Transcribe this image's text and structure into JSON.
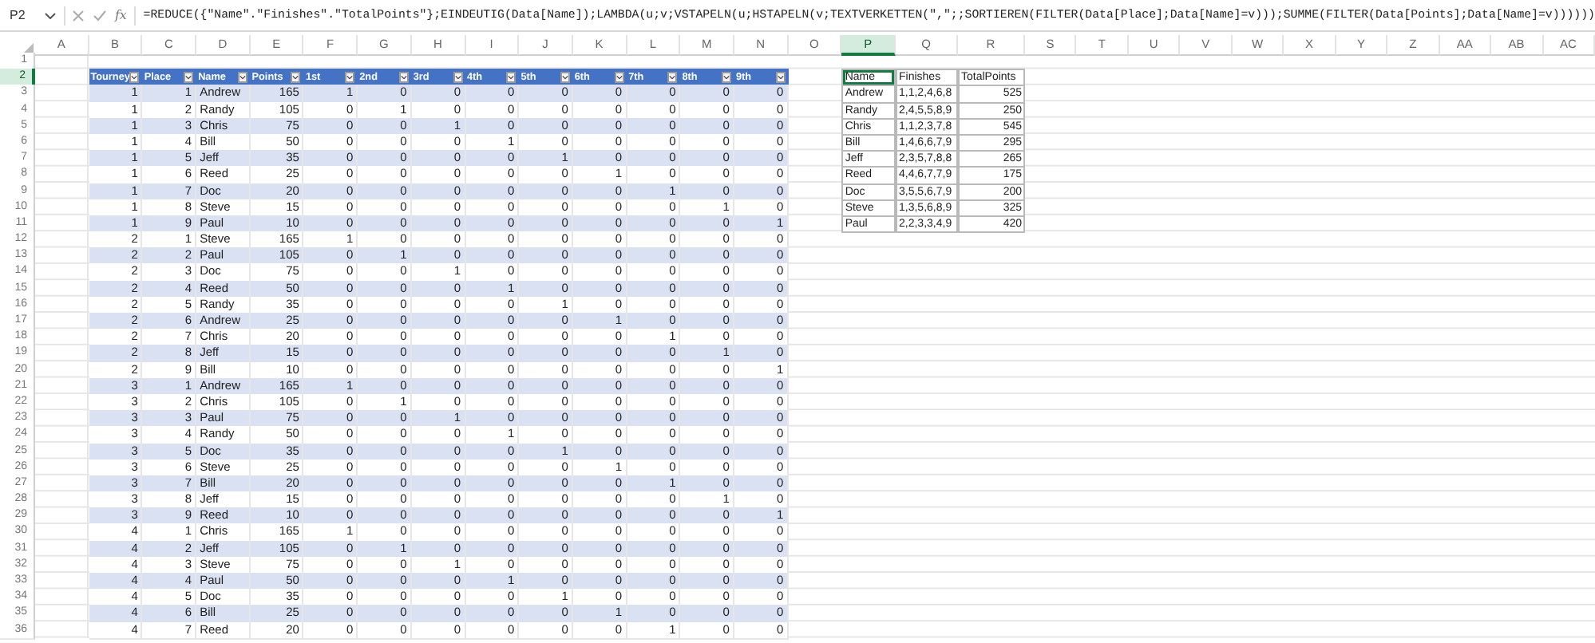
{
  "formula_bar": {
    "name_box": "P2",
    "function_label": "fx",
    "formula": "=REDUCE({\"Name\".\"Finishes\".\"TotalPoints\"};EINDEUTIG(Data[Name]);LAMBDA(u;v;VSTAPELN(u;HSTAPELN(v;TEXTVERKETTEN(\",\";;SORTIEREN(FILTER(Data[Place];Data[Name]=v)));SUMME(FILTER(Data[Points];Data[Name]=v))))))"
  },
  "column_headers": [
    {
      "label": "A",
      "selected": false
    },
    {
      "label": "B",
      "selected": false
    },
    {
      "label": "C",
      "selected": false
    },
    {
      "label": "D",
      "selected": false
    },
    {
      "label": "E",
      "selected": false
    },
    {
      "label": "F",
      "selected": false
    },
    {
      "label": "G",
      "selected": false
    },
    {
      "label": "H",
      "selected": false
    },
    {
      "label": "I",
      "selected": false
    },
    {
      "label": "J",
      "selected": false
    },
    {
      "label": "K",
      "selected": false
    },
    {
      "label": "L",
      "selected": false
    },
    {
      "label": "M",
      "selected": false
    },
    {
      "label": "N",
      "selected": false
    },
    {
      "label": "O",
      "selected": false
    },
    {
      "label": "P",
      "selected": true
    },
    {
      "label": "Q",
      "selected": false
    },
    {
      "label": "R",
      "selected": false
    },
    {
      "label": "S",
      "selected": false
    },
    {
      "label": "T",
      "selected": false
    },
    {
      "label": "U",
      "selected": false
    },
    {
      "label": "V",
      "selected": false
    },
    {
      "label": "W",
      "selected": false
    },
    {
      "label": "X",
      "selected": false
    },
    {
      "label": "Y",
      "selected": false
    },
    {
      "label": "Z",
      "selected": false
    },
    {
      "label": "AA",
      "selected": false
    },
    {
      "label": "AB",
      "selected": false
    },
    {
      "label": "AC",
      "selected": false
    }
  ],
  "row_headers": [
    {
      "label": "1",
      "selected": false
    },
    {
      "label": "2",
      "selected": true
    },
    {
      "label": "3",
      "selected": false
    },
    {
      "label": "4",
      "selected": false
    },
    {
      "label": "5",
      "selected": false
    },
    {
      "label": "6",
      "selected": false
    },
    {
      "label": "7",
      "selected": false
    },
    {
      "label": "8",
      "selected": false
    },
    {
      "label": "9",
      "selected": false
    },
    {
      "label": "10",
      "selected": false
    },
    {
      "label": "11",
      "selected": false
    },
    {
      "label": "12",
      "selected": false
    },
    {
      "label": "13",
      "selected": false
    },
    {
      "label": "14",
      "selected": false
    },
    {
      "label": "15",
      "selected": false
    },
    {
      "label": "16",
      "selected": false
    },
    {
      "label": "17",
      "selected": false
    },
    {
      "label": "18",
      "selected": false
    },
    {
      "label": "19",
      "selected": false
    },
    {
      "label": "20",
      "selected": false
    },
    {
      "label": "21",
      "selected": false
    },
    {
      "label": "22",
      "selected": false
    },
    {
      "label": "23",
      "selected": false
    },
    {
      "label": "24",
      "selected": false
    },
    {
      "label": "25",
      "selected": false
    },
    {
      "label": "26",
      "selected": false
    },
    {
      "label": "27",
      "selected": false
    },
    {
      "label": "28",
      "selected": false
    },
    {
      "label": "29",
      "selected": false
    },
    {
      "label": "30",
      "selected": false
    },
    {
      "label": "31",
      "selected": false
    },
    {
      "label": "32",
      "selected": false
    },
    {
      "label": "33",
      "selected": false
    },
    {
      "label": "34",
      "selected": false
    },
    {
      "label": "35",
      "selected": false
    },
    {
      "label": "36",
      "selected": false
    }
  ],
  "data_table": {
    "headers": [
      "Tourney",
      "Place",
      "Name",
      "Points",
      "1st",
      "2nd",
      "3rd",
      "4th",
      "5th",
      "6th",
      "7th",
      "8th",
      "9th"
    ],
    "rows": [
      [
        "1",
        "1",
        "Andrew",
        "165",
        "1",
        "0",
        "0",
        "0",
        "0",
        "0",
        "0",
        "0",
        "0"
      ],
      [
        "1",
        "2",
        "Randy",
        "105",
        "0",
        "1",
        "0",
        "0",
        "0",
        "0",
        "0",
        "0",
        "0"
      ],
      [
        "1",
        "3",
        "Chris",
        "75",
        "0",
        "0",
        "1",
        "0",
        "0",
        "0",
        "0",
        "0",
        "0"
      ],
      [
        "1",
        "4",
        "Bill",
        "50",
        "0",
        "0",
        "0",
        "1",
        "0",
        "0",
        "0",
        "0",
        "0"
      ],
      [
        "1",
        "5",
        "Jeff",
        "35",
        "0",
        "0",
        "0",
        "0",
        "1",
        "0",
        "0",
        "0",
        "0"
      ],
      [
        "1",
        "6",
        "Reed",
        "25",
        "0",
        "0",
        "0",
        "0",
        "0",
        "1",
        "0",
        "0",
        "0"
      ],
      [
        "1",
        "7",
        "Doc",
        "20",
        "0",
        "0",
        "0",
        "0",
        "0",
        "0",
        "1",
        "0",
        "0"
      ],
      [
        "1",
        "8",
        "Steve",
        "15",
        "0",
        "0",
        "0",
        "0",
        "0",
        "0",
        "0",
        "1",
        "0"
      ],
      [
        "1",
        "9",
        "Paul",
        "10",
        "0",
        "0",
        "0",
        "0",
        "0",
        "0",
        "0",
        "0",
        "1"
      ],
      [
        "2",
        "1",
        "Steve",
        "165",
        "1",
        "0",
        "0",
        "0",
        "0",
        "0",
        "0",
        "0",
        "0"
      ],
      [
        "2",
        "2",
        "Paul",
        "105",
        "0",
        "1",
        "0",
        "0",
        "0",
        "0",
        "0",
        "0",
        "0"
      ],
      [
        "2",
        "3",
        "Doc",
        "75",
        "0",
        "0",
        "1",
        "0",
        "0",
        "0",
        "0",
        "0",
        "0"
      ],
      [
        "2",
        "4",
        "Reed",
        "50",
        "0",
        "0",
        "0",
        "1",
        "0",
        "0",
        "0",
        "0",
        "0"
      ],
      [
        "2",
        "5",
        "Randy",
        "35",
        "0",
        "0",
        "0",
        "0",
        "1",
        "0",
        "0",
        "0",
        "0"
      ],
      [
        "2",
        "6",
        "Andrew",
        "25",
        "0",
        "0",
        "0",
        "0",
        "0",
        "1",
        "0",
        "0",
        "0"
      ],
      [
        "2",
        "7",
        "Chris",
        "20",
        "0",
        "0",
        "0",
        "0",
        "0",
        "0",
        "1",
        "0",
        "0"
      ],
      [
        "2",
        "8",
        "Jeff",
        "15",
        "0",
        "0",
        "0",
        "0",
        "0",
        "0",
        "0",
        "1",
        "0"
      ],
      [
        "2",
        "9",
        "Bill",
        "10",
        "0",
        "0",
        "0",
        "0",
        "0",
        "0",
        "0",
        "0",
        "1"
      ],
      [
        "3",
        "1",
        "Andrew",
        "165",
        "1",
        "0",
        "0",
        "0",
        "0",
        "0",
        "0",
        "0",
        "0"
      ],
      [
        "3",
        "2",
        "Chris",
        "105",
        "0",
        "1",
        "0",
        "0",
        "0",
        "0",
        "0",
        "0",
        "0"
      ],
      [
        "3",
        "3",
        "Paul",
        "75",
        "0",
        "0",
        "1",
        "0",
        "0",
        "0",
        "0",
        "0",
        "0"
      ],
      [
        "3",
        "4",
        "Randy",
        "50",
        "0",
        "0",
        "0",
        "1",
        "0",
        "0",
        "0",
        "0",
        "0"
      ],
      [
        "3",
        "5",
        "Doc",
        "35",
        "0",
        "0",
        "0",
        "0",
        "1",
        "0",
        "0",
        "0",
        "0"
      ],
      [
        "3",
        "6",
        "Steve",
        "25",
        "0",
        "0",
        "0",
        "0",
        "0",
        "1",
        "0",
        "0",
        "0"
      ],
      [
        "3",
        "7",
        "Bill",
        "20",
        "0",
        "0",
        "0",
        "0",
        "0",
        "0",
        "1",
        "0",
        "0"
      ],
      [
        "3",
        "8",
        "Jeff",
        "15",
        "0",
        "0",
        "0",
        "0",
        "0",
        "0",
        "0",
        "1",
        "0"
      ],
      [
        "3",
        "9",
        "Reed",
        "10",
        "0",
        "0",
        "0",
        "0",
        "0",
        "0",
        "0",
        "0",
        "1"
      ],
      [
        "4",
        "1",
        "Chris",
        "165",
        "1",
        "0",
        "0",
        "0",
        "0",
        "0",
        "0",
        "0",
        "0"
      ],
      [
        "4",
        "2",
        "Jeff",
        "105",
        "0",
        "1",
        "0",
        "0",
        "0",
        "0",
        "0",
        "0",
        "0"
      ],
      [
        "4",
        "3",
        "Steve",
        "75",
        "0",
        "0",
        "1",
        "0",
        "0",
        "0",
        "0",
        "0",
        "0"
      ],
      [
        "4",
        "4",
        "Paul",
        "50",
        "0",
        "0",
        "0",
        "1",
        "0",
        "0",
        "0",
        "0",
        "0"
      ],
      [
        "4",
        "5",
        "Doc",
        "35",
        "0",
        "0",
        "0",
        "0",
        "1",
        "0",
        "0",
        "0",
        "0"
      ],
      [
        "4",
        "6",
        "Bill",
        "25",
        "0",
        "0",
        "0",
        "0",
        "0",
        "1",
        "0",
        "0",
        "0"
      ],
      [
        "4",
        "7",
        "Reed",
        "20",
        "0",
        "0",
        "0",
        "0",
        "0",
        "0",
        "1",
        "0",
        "0"
      ]
    ]
  },
  "result_table": {
    "headers": [
      "Name",
      "Finishes",
      "TotalPoints"
    ],
    "rows": [
      [
        "Andrew",
        "1,1,2,4,6,8",
        "525"
      ],
      [
        "Randy",
        "2,4,5,5,8,9",
        "250"
      ],
      [
        "Chris",
        "1,1,2,3,7,8",
        "545"
      ],
      [
        "Bill",
        "1,4,6,6,7,9",
        "295"
      ],
      [
        "Jeff",
        "2,3,5,7,8,8",
        "265"
      ],
      [
        "Reed",
        "4,4,6,7,7,9",
        "175"
      ],
      [
        "Doc",
        "3,5,5,6,7,9",
        "200"
      ],
      [
        "Steve",
        "1,3,5,6,8,9",
        "325"
      ],
      [
        "Paul",
        "2,2,3,3,4,9",
        "420"
      ]
    ]
  }
}
